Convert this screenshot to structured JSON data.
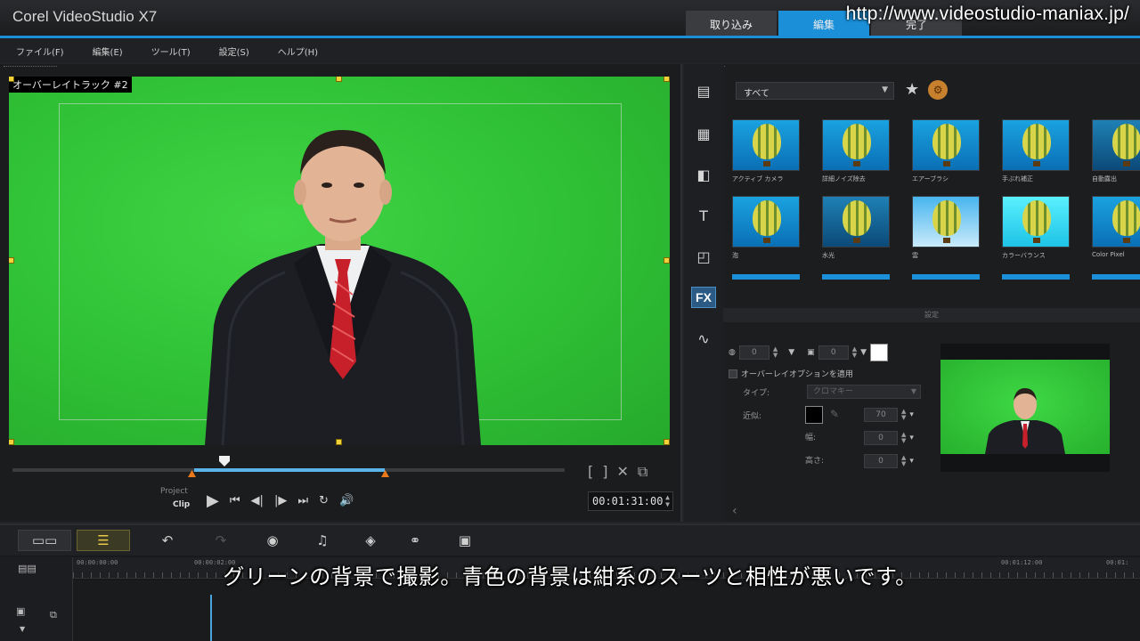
{
  "app": {
    "title": "Corel VideoStudio X7",
    "steps": [
      "取り込み",
      "編集",
      "完了"
    ],
    "overlay_url": "http://www.videostudio-maniax.jp/"
  },
  "menu": [
    "ファイル(F)",
    "編集(E)",
    "ツール(T)",
    "設定(S)",
    "ヘルプ(H)"
  ],
  "player": {
    "track_label": "オーバーレイトラック #2",
    "mode_project": "Project",
    "mode_clip": "Clip",
    "timecode": "00:01:31:00",
    "mark_in": "[",
    "mark_out": "]"
  },
  "library": {
    "filter": "すべて",
    "effects": [
      {
        "label": "アクティブ カメラ",
        "style": "normal"
      },
      {
        "label": "詳細ノイズ除去",
        "style": "normal"
      },
      {
        "label": "エアーブラシ",
        "style": "normal"
      },
      {
        "label": "手ぶれ補正",
        "style": "normal"
      },
      {
        "label": "自動露出",
        "style": "normal"
      },
      {
        "label": "泡",
        "style": "normal"
      },
      {
        "label": "水光",
        "style": "dark"
      },
      {
        "label": "雲",
        "style": "sky"
      },
      {
        "label": "カラーバランス",
        "style": "cyan"
      },
      {
        "label": "Color Pixel",
        "style": "normal"
      }
    ],
    "section_label": "設定"
  },
  "options": {
    "border_width": "0",
    "edge_width": "0",
    "overlay_option_label": "オーバーレイオプションを適用",
    "type_label": "タイプ:",
    "type_value": "クロマキー",
    "similarity_label": "近似:",
    "similarity_value": "70",
    "width_label": "幅:",
    "width_value": "0",
    "height_label": "高さ:",
    "height_value": "0",
    "key_color": "#000000",
    "border_color": "#ffffff"
  },
  "timeline": {
    "ruler_start": "00:00:00:00",
    "ruler_mid": "00:00:02:00",
    "ruler_right": "00:01:12:00",
    "ruler_far": "00:01:"
  },
  "subtitle": "グリーンの背景で撮影。青色の背景は紺系のスーツと相性が悪いです。",
  "colors": {
    "accent": "#1b8fd8",
    "chroma_green": "#2fc236",
    "handle_yellow": "#f2d23b",
    "trim_orange": "#e87a1c"
  }
}
